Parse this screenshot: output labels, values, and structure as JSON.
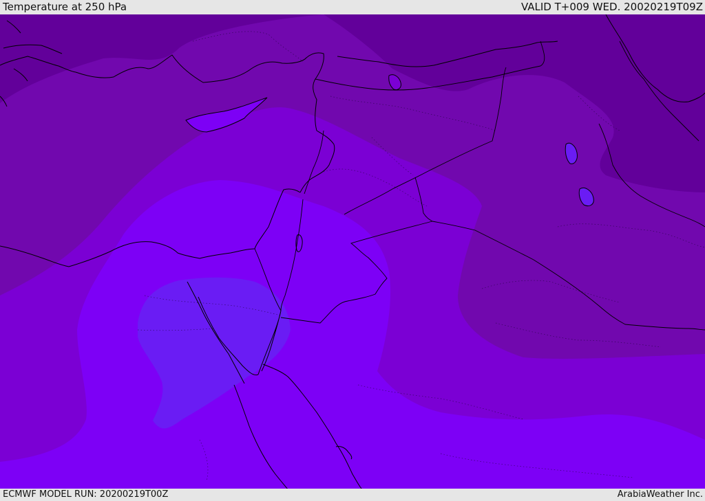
{
  "header": {
    "title": "Temperature at 250 hPa",
    "valid": "VALID T+009 WED. 20020219T09Z"
  },
  "footer": {
    "model_run": "ECMWF MODEL RUN: 20200219T00Z",
    "credit": "ArabiaWeather Inc."
  },
  "colors": {
    "band_coldest": "#62009a",
    "band_cold": "#7108ae",
    "band_mid": "#7b00d4",
    "band_warm": "#7d00f6",
    "band_warmest": "#6a1cf4",
    "lines": "#000000"
  }
}
